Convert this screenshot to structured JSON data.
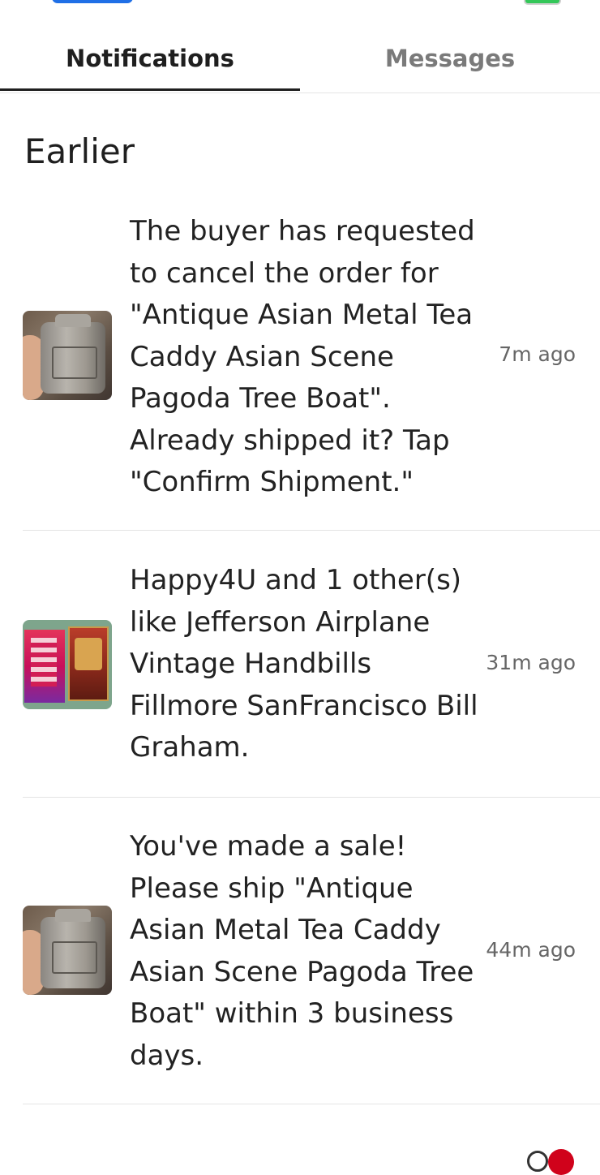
{
  "tabs": [
    {
      "label": "Notifications",
      "active": true
    },
    {
      "label": "Messages",
      "active": false
    }
  ],
  "section": {
    "title": "Earlier"
  },
  "notifications": [
    {
      "text": "The buyer has requested to cancel the order for \"Antique Asian Metal Tea Caddy Asian Scene Pagoda Tree Boat\". Already shipped it? Tap \"Confirm Shipment.\"",
      "time": "7m ago",
      "thumbnail": "tea-caddy-photo"
    },
    {
      "text": "Happy4U and 1 other(s) like Jefferson Airplane Vintage Handbills Fillmore SanFrancisco Bill Graham.",
      "time": "31m ago",
      "thumbnail": "handbills-photo"
    },
    {
      "text": "You've made a sale! Please ship \"Antique Asian Metal Tea Caddy Asian Scene Pagoda Tree Boat\" within 3 business days.",
      "time": "44m ago",
      "thumbnail": "tea-caddy-photo"
    }
  ],
  "colors": {
    "text_primary": "#1f1f1f",
    "text_secondary": "#7a7a7a",
    "divider": "#e4e4e4",
    "badge": "#d0021b"
  }
}
